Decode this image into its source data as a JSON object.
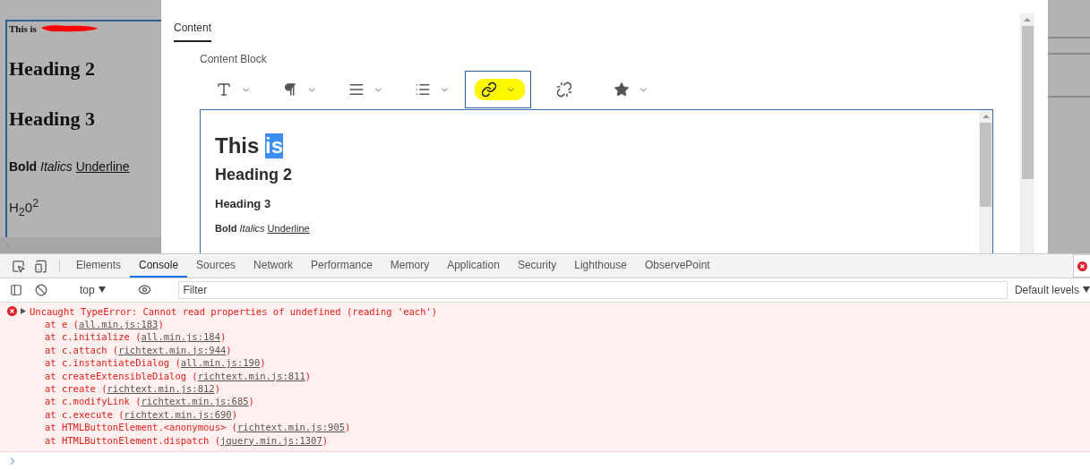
{
  "preview": {
    "intro": "This is",
    "redacted": true,
    "heading_2": "Heading 2",
    "heading_3": "Heading 3",
    "bold": "Bold",
    "italic": "Italics",
    "underline": "Underline",
    "formula": "H$_{2}$0$^{2}$"
  },
  "dialog": {
    "tabs": [
      {
        "label": "Content",
        "selected": true
      }
    ],
    "section_label": "Content Block",
    "toolbar": [
      {
        "kind": "text",
        "dropdown": true,
        "selected": false,
        "highlighted": false
      },
      {
        "kind": "paragraph",
        "dropdown": true,
        "selected": false,
        "highlighted": false
      },
      {
        "kind": "align",
        "dropdown": true,
        "selected": false,
        "highlighted": false
      },
      {
        "kind": "list",
        "dropdown": true,
        "selected": false,
        "highlighted": false
      },
      {
        "kind": "link",
        "dropdown": true,
        "selected": true,
        "highlighted": true
      },
      {
        "kind": "unlink",
        "dropdown": false,
        "selected": false,
        "highlighted": false
      },
      {
        "kind": "star",
        "dropdown": true,
        "selected": false,
        "highlighted": false
      }
    ],
    "editor": {
      "title": [
        {
          "text": "This ",
          "selected": false
        },
        {
          "text": "is",
          "selected": true
        }
      ],
      "heading_2": "Heading 2",
      "heading_3": "Heading 3",
      "bold": "Bold",
      "italic": "Italics",
      "underline": "Underline"
    }
  },
  "devtools": {
    "tabs": [
      {
        "label": "Elements",
        "selected": false
      },
      {
        "label": "Console",
        "selected": true
      },
      {
        "label": "Sources",
        "selected": false
      },
      {
        "label": "Network",
        "selected": false
      },
      {
        "label": "Performance",
        "selected": false
      },
      {
        "label": "Memory",
        "selected": false
      },
      {
        "label": "Application",
        "selected": false
      },
      {
        "label": "Security",
        "selected": false
      },
      {
        "label": "Lighthouse",
        "selected": false
      },
      {
        "label": "ObservePoint",
        "selected": false
      }
    ],
    "context": "top",
    "filter": {
      "placeholder": "Filter"
    },
    "levels": "Default levels",
    "error": {
      "expanded": false,
      "message": "Uncaught TypeError: Cannot read properties of undefined (reading 'each')",
      "stack": [
        {
          "prefix": "at e (",
          "link": "all.min.js:183",
          "suffix": ")"
        },
        {
          "prefix": "at c.initialize (",
          "link": "all.min.js:184",
          "suffix": ")"
        },
        {
          "prefix": "at c.attach (",
          "link": "richtext.min.js:944",
          "suffix": ")"
        },
        {
          "prefix": "at c.instantiateDialog (",
          "link": "all.min.js:190",
          "suffix": ")"
        },
        {
          "prefix": "at createExtensibleDialog (",
          "link": "richtext.min.js:811",
          "suffix": ")"
        },
        {
          "prefix": "at create (",
          "link": "richtext.min.js:812",
          "suffix": ")"
        },
        {
          "prefix": "at c.modifyLink (",
          "link": "richtext.min.js:685",
          "suffix": ")"
        },
        {
          "prefix": "at c.execute (",
          "link": "richtext.min.js:690",
          "suffix": ")"
        },
        {
          "prefix": "at HTMLButtonElement.<anonymous> (",
          "link": "richtext.min.js:905",
          "suffix": ")"
        },
        {
          "prefix": "at HTMLButtonElement.dispatch (",
          "link": "jquery.min.js:1307",
          "suffix": ")"
        }
      ]
    }
  }
}
